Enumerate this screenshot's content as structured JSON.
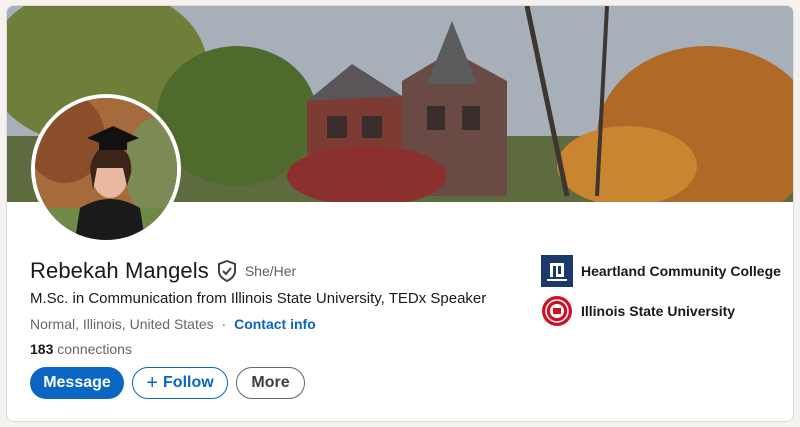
{
  "profile": {
    "name": "Rebekah Mangels",
    "pronouns": "She/Her",
    "headline": "M.Sc. in Communication from Illinois State University, TEDx Speaker",
    "location": "Normal, Illinois, United States",
    "location_separator": "·",
    "contact_info_label": "Contact info",
    "connections_count": "183",
    "connections_label": "connections"
  },
  "actions": {
    "message_label": "Message",
    "follow_label": "Follow",
    "more_label": "More"
  },
  "education": [
    {
      "name": "Heartland Community College",
      "logo": "heartland-logo"
    },
    {
      "name": "Illinois State University",
      "logo": "isu-seal-logo"
    }
  ],
  "colors": {
    "primary": "#0a66c2",
    "text": "#191919",
    "muted": "#666666",
    "isu_red": "#ce1126",
    "heartland_navy": "#1b3a6b"
  }
}
